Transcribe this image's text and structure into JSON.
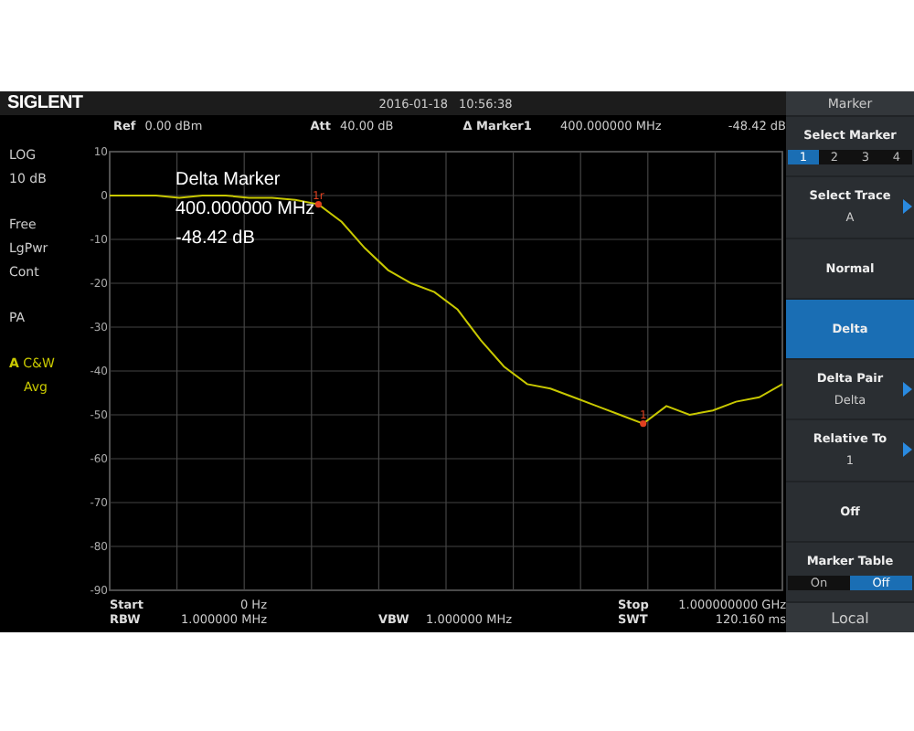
{
  "top_bar": {
    "logo": "SIGLENT",
    "date": "2016-01-18",
    "time": "10:56:38"
  },
  "header": {
    "ref_label": "Ref",
    "ref_value": "0.00 dBm",
    "att_label": "Att",
    "att_value": "40.00 dB",
    "marker_label": "Δ Marker1",
    "marker_freq": "400.000000 MHz",
    "marker_level": "-48.42 dB"
  },
  "left_panel": [
    {
      "text": "LOG",
      "kind": "plain"
    },
    {
      "text": "10 dB",
      "kind": "plain"
    },
    {
      "text": "Free",
      "kind": "gap"
    },
    {
      "text": "LgPwr",
      "kind": "plain"
    },
    {
      "text": "Cont",
      "kind": "plain"
    },
    {
      "text": "PA",
      "kind": "gap"
    },
    {
      "text": "C&W",
      "kind": "trace",
      "color": "#c8c800"
    },
    {
      "text": "Avg",
      "kind": "trace-sub",
      "color": "#c8c800"
    }
  ],
  "marker_readout": {
    "title": "Delta Marker",
    "freq": "400.000000 MHz",
    "level": "-48.42 dB"
  },
  "markers": [
    {
      "label": "1r"
    },
    {
      "label": "1"
    }
  ],
  "chart_data": {
    "type": "line",
    "categories": [
      null,
      null,
      null,
      null,
      null,
      null,
      null,
      null,
      null,
      null,
      null,
      null,
      null,
      null,
      null,
      null,
      null,
      null,
      null,
      null,
      null,
      null,
      null,
      null,
      null,
      null,
      null,
      null,
      null,
      null
    ],
    "series": [
      {
        "name": "A",
        "color": "#c8c800",
        "values": [
          0,
          0,
          0,
          -0.5,
          0,
          0,
          -0.5,
          -0.5,
          -1,
          -2,
          -6,
          -12,
          -17,
          -20,
          -22,
          -26,
          -33,
          -39,
          -43,
          -44,
          -46,
          -48,
          -50,
          -52,
          -48,
          -50,
          -49,
          -47,
          -46,
          -43
        ]
      }
    ],
    "ylim": [
      -90,
      10
    ],
    "grid": true,
    "yticks": [
      {
        "value": 10,
        "label": "10"
      },
      {
        "value": 0,
        "label": "0"
      },
      {
        "value": -10,
        "label": "-10"
      },
      {
        "value": -20,
        "label": "-20"
      },
      {
        "value": -30,
        "label": "-30"
      },
      {
        "value": -40,
        "label": "-40"
      },
      {
        "value": -50,
        "label": "-50"
      },
      {
        "value": -60,
        "label": "-60"
      },
      {
        "value": -70,
        "label": "-70"
      },
      {
        "value": -80,
        "label": "-80"
      },
      {
        "value": -90,
        "label": "-90"
      }
    ]
  },
  "bottom": {
    "start_label": "Start",
    "start_value": "0 Hz",
    "stop_label": "Stop",
    "stop_value": "1.000000000 GHz",
    "rbw_label": "RBW",
    "rbw_value": "1.000000 MHz",
    "vbw_label": "VBW",
    "vbw_value": "1.000000 MHz",
    "swt_label": "SWT",
    "swt_value": "120.160 ms"
  },
  "menu": {
    "title": "Marker",
    "items": [
      {
        "kind": "select",
        "label": "Select Marker",
        "options": [
          {
            "label": "1",
            "selected": true
          },
          {
            "label": "2",
            "selected": false
          },
          {
            "label": "3",
            "selected": false
          },
          {
            "label": "4",
            "selected": false
          }
        ]
      },
      {
        "kind": "button",
        "label": "Select Trace",
        "value": "A",
        "submenu": true,
        "selected": false
      },
      {
        "kind": "button",
        "label": "Normal",
        "submenu": false,
        "selected": false
      },
      {
        "kind": "button",
        "label": "Delta",
        "submenu": false,
        "selected": true
      },
      {
        "kind": "button",
        "label": "Delta Pair",
        "value": "Delta",
        "submenu": true,
        "selected": false
      },
      {
        "kind": "button",
        "label": "Relative To",
        "value": "1",
        "submenu": true,
        "selected": false
      },
      {
        "kind": "button",
        "label": "Off",
        "submenu": false,
        "selected": false
      },
      {
        "kind": "select",
        "label": "Marker Table",
        "options": [
          {
            "label": "On",
            "selected": false
          },
          {
            "label": "Off",
            "selected": true
          }
        ]
      }
    ],
    "footer": "Local"
  }
}
